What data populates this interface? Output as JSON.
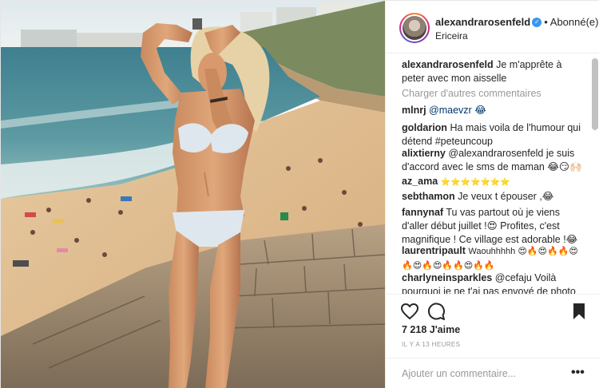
{
  "post": {
    "username": "alexandrarosenfeld",
    "follow_status": "Abonné(e)",
    "separator": "•",
    "location": "Ericeira",
    "caption_user": "alexandrarosenfeld",
    "caption_text": "Je m'apprête à peter avec mon aisselle",
    "load_more": "Charger d'autres commentaires",
    "likes": "7 218 J'aime",
    "timestamp": "IL Y A 13 HEURES",
    "add_comment_placeholder": "Ajouter un commentaire...",
    "more_options": "•••"
  },
  "comments": [
    {
      "user": "mlnrj",
      "text": "@maevzr 😂"
    },
    {
      "user": "goldarion",
      "text": "Ha mais voila de l'humour qui détend #peteuncoup"
    },
    {
      "user": "alixtierny",
      "text": "@alexandrarosenfeld je suis d'accord avec le sms de maman 😂😏🙌🏻"
    },
    {
      "user": "az_ama",
      "text": "⭐⭐⭐⭐⭐⭐⭐"
    },
    {
      "user": "sebthamon",
      "text": "Je veux t épouser ,😂"
    },
    {
      "user": "fannynaf",
      "text": "Tu vas partout où je viens d'aller début juillet !😍 Profites, c'est magnifique ! Ce village est adorable !😂"
    },
    {
      "user": "laurentripault",
      "text": "Waouhhhhh 😍🔥😍🔥🔥😍🔥😍🔥😍🔥🔥😍🔥🔥"
    },
    {
      "user": "charlyneinsparkles",
      "text": "@cefaju Voilà pourquoi je ne t'ai pas envoyé de photo"
    }
  ],
  "icons": {
    "verified": "verified-badge-icon",
    "like": "heart-outline-icon",
    "comment": "speech-bubble-icon",
    "save": "bookmark-icon"
  },
  "colors": {
    "link": "#003569",
    "muted": "#999999",
    "verified": "#3897f0",
    "text": "#262626"
  }
}
